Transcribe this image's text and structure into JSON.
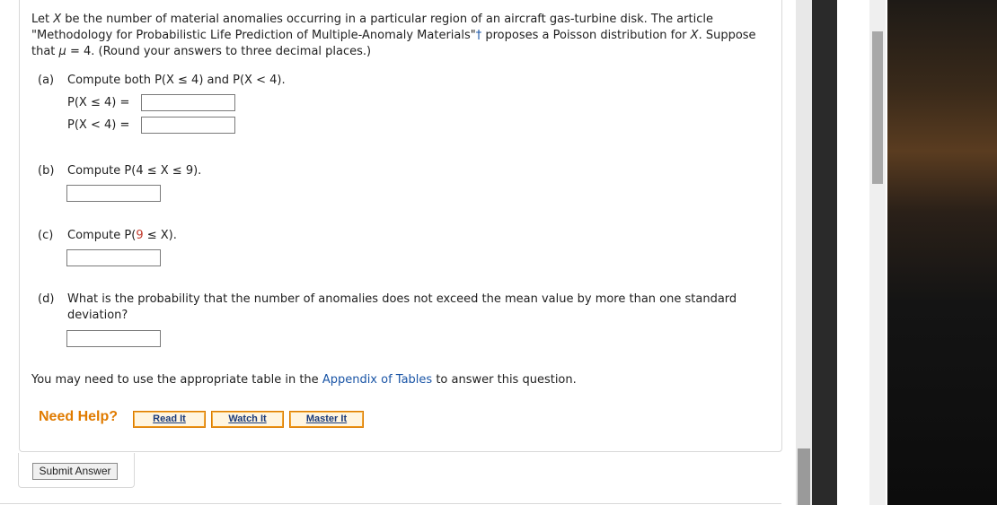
{
  "question": {
    "intro_a": "Let ",
    "intro_x1": "X",
    "intro_b": " be the number of material anomalies occurring in a particular region of an aircraft gas-turbine disk. The article \"Methodology for Probabilistic Life Prediction of Multiple-Anomaly Materials\"",
    "dagger": "†",
    "intro_c": " proposes a Poisson distribution for ",
    "intro_x2": "X",
    "intro_d": ". Suppose that ",
    "mu": "μ",
    "intro_e": " = 4. (Round your answers to three decimal places.)"
  },
  "parts": {
    "a": {
      "label": "(a)",
      "text": "Compute both P(X ≤ 4) and P(X < 4).",
      "eq1": "P(X ≤ 4)  =",
      "eq2": "P(X < 4)  ="
    },
    "b": {
      "label": "(b)",
      "text": "Compute P(4 ≤ X ≤ 9)."
    },
    "c": {
      "label": "(c)",
      "text_pre": "Compute P(",
      "nine": "9",
      "text_post": " ≤ X)."
    },
    "d": {
      "label": "(d)",
      "text": "What is the probability that the number of anomalies does not exceed the mean value by more than one standard deviation?"
    }
  },
  "appendix": {
    "pre": "You may need to use the appropriate table in the ",
    "link": "Appendix of Tables",
    "post": " to answer this question."
  },
  "help": {
    "title": "Need Help?",
    "read": "Read It",
    "watch": "Watch It",
    "master": "Master It"
  },
  "submit_label": "Submit Answer",
  "colors": {
    "accent_orange": "#e07b00",
    "link_blue": "#1a55a6"
  }
}
